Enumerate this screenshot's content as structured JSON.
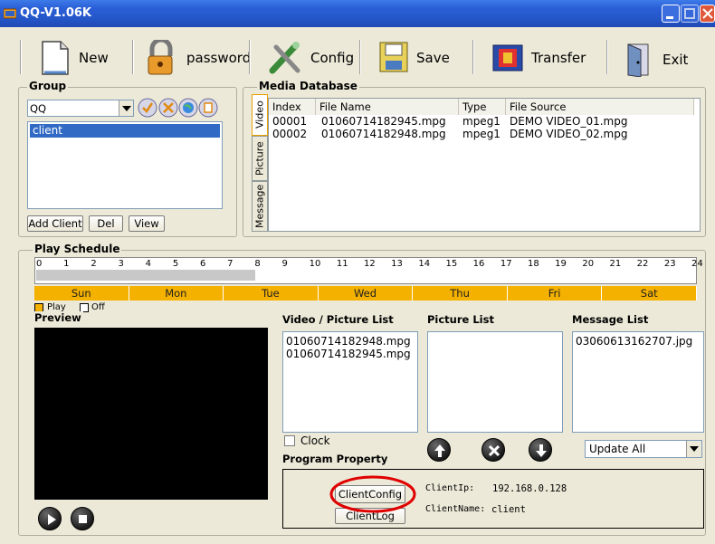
{
  "window": {
    "title": "QQ-V1.06K"
  },
  "toolbar": {
    "new": "New",
    "password": "password",
    "config": "Config",
    "save": "Save",
    "transfer": "Transfer",
    "exit": "Exit"
  },
  "group": {
    "title": "Group",
    "selected": "QQ",
    "items": [
      "client"
    ],
    "add_client": "Add Client",
    "del": "Del",
    "view": "View"
  },
  "media": {
    "title": "Media Database",
    "tabs": [
      "Video",
      "Picture",
      "Message"
    ],
    "columns": [
      "Index",
      "File Name",
      "Type",
      "File Source"
    ],
    "rows": [
      {
        "index": "00001",
        "file": "01060714182945.mpg",
        "type": "mpeg1",
        "source": "DEMO VIDEO_01.mpg"
      },
      {
        "index": "00002",
        "file": "01060714182948.mpg",
        "type": "mpeg1",
        "source": "DEMO VIDEO_02.mpg"
      }
    ]
  },
  "schedule": {
    "title": "Play Schedule",
    "hours": [
      "0",
      "1",
      "2",
      "3",
      "4",
      "5",
      "6",
      "7",
      "8",
      "9",
      "10",
      "11",
      "12",
      "13",
      "14",
      "15",
      "16",
      "17",
      "18",
      "19",
      "20",
      "21",
      "22",
      "23",
      "24"
    ],
    "days": [
      "Sun",
      "Mon",
      "Tue",
      "Wed",
      "Thu",
      "Fri",
      "Sat"
    ],
    "legend_play": "Play",
    "legend_off": "Off",
    "play_color": "#f5b100"
  },
  "preview": {
    "title": "Preview"
  },
  "lists": {
    "video_title": "Video / Picture List",
    "video_items": [
      "01060714182948.mpg",
      "01060714182945.mpg"
    ],
    "picture_title": "Picture List",
    "message_title": "Message List",
    "message_items": [
      "03060613162707.jpg"
    ],
    "clock": "Clock",
    "update": "Update All"
  },
  "program": {
    "title": "Program Property",
    "client_config": "ClientConfig",
    "client_log": "ClientLog",
    "ip_label": "ClientIp:",
    "ip_value": "192.168.0.128",
    "name_label": "ClientName:",
    "name_value": "client"
  },
  "annotation_color": "#e00000"
}
